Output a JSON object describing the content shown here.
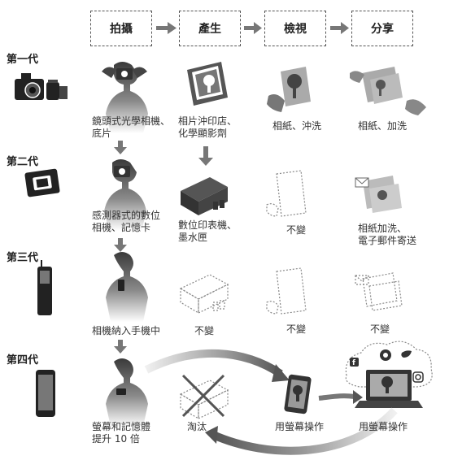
{
  "header": {
    "steps": [
      "拍攝",
      "產生",
      "檢視",
      "分享"
    ]
  },
  "generations": [
    {
      "title": "第一代",
      "capture": "鏡頭式光學相機、\n底片",
      "produce": "相片沖印店、\n化學顯影劑",
      "view": "相紙、沖洗",
      "share": "相紙、加洗"
    },
    {
      "title": "第二代",
      "capture": "感測器式的數位\n相機、記憶卡",
      "produce": "數位印表機、\n墨水匣",
      "view": "不變",
      "share": "相紙加洗、\n電子郵件寄送"
    },
    {
      "title": "第三代",
      "capture": "相機納入手機中",
      "produce": "不變",
      "view": "不變",
      "share": "不變"
    },
    {
      "title": "第四代",
      "capture": "螢幕和記憶體\n提升 10 倍",
      "produce": "淘汰",
      "view": "用螢幕操作",
      "share": "用螢幕操作"
    }
  ],
  "colors": {
    "icon": "#333333",
    "dashed": "#777777",
    "arrow": "#666666",
    "gradient_light": "#e6e6e6"
  }
}
